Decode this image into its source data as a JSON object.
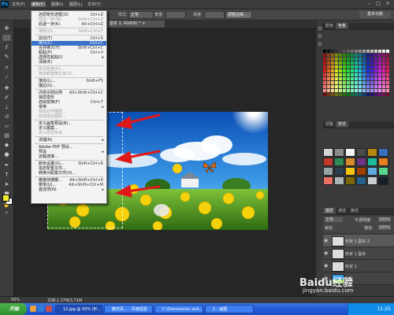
{
  "menubar": {
    "logo": "Ps",
    "items": [
      "文件(F)",
      "编辑(E)",
      "图像(I)",
      "图层(L)",
      "文字(Y)"
    ]
  },
  "optbar": {
    "style_label": "样式:",
    "style_value": "正常",
    "width_label": "宽度:",
    "height_label": "高度:",
    "refine_button": "调整边缘..."
  },
  "document_tab": "副本 2, RGB/8) * ×",
  "edit_menu": {
    "items": [
      {
        "label": "还原矩形选框(O)",
        "shortcut": "Ctrl+Z",
        "disabled": false
      },
      {
        "label": "前进一步(W)",
        "shortcut": "Shift+Ctrl+Z",
        "disabled": true
      },
      {
        "label": "后退一步(K)",
        "shortcut": "Alt+Ctrl+Z",
        "disabled": false
      },
      {
        "label": "",
        "separator": true
      },
      {
        "label": "渐隐(D)...",
        "shortcut": "Shift+Ctrl+F",
        "disabled": true
      },
      {
        "label": "",
        "separator": true
      },
      {
        "label": "剪切(T)",
        "shortcut": "Ctrl+X",
        "disabled": false
      },
      {
        "label": "拷贝(C)",
        "shortcut": "Ctrl+C",
        "disabled": false,
        "selected": true
      },
      {
        "label": "合并拷贝(Y)",
        "shortcut": "Shift+Ctrl+C",
        "disabled": false
      },
      {
        "label": "粘贴(P)",
        "shortcut": "Ctrl+V",
        "disabled": false
      },
      {
        "label": "选择性粘贴(I)",
        "shortcut": "",
        "disabled": false,
        "submenu": true
      },
      {
        "label": "清除(E)",
        "shortcut": "",
        "disabled": false
      },
      {
        "label": "",
        "separator": true
      },
      {
        "label": "拼写检查(H)...",
        "shortcut": "",
        "disabled": true
      },
      {
        "label": "查找和替换文本(X)...",
        "shortcut": "",
        "disabled": true
      },
      {
        "label": "",
        "separator": true
      },
      {
        "label": "填充(L)...",
        "shortcut": "Shift+F5",
        "disabled": false
      },
      {
        "label": "描边(S)...",
        "shortcut": "",
        "disabled": false
      },
      {
        "label": "",
        "separator": true
      },
      {
        "label": "内容识别比例",
        "shortcut": "Alt+Shift+Ctrl+C",
        "disabled": false
      },
      {
        "label": "操控变形",
        "shortcut": "",
        "disabled": false
      },
      {
        "label": "自由变换(F)",
        "shortcut": "Ctrl+T",
        "disabled": false
      },
      {
        "label": "变换",
        "shortcut": "",
        "disabled": false,
        "submenu": true
      },
      {
        "label": "自动对齐图层...",
        "shortcut": "",
        "disabled": true
      },
      {
        "label": "自动混合图层...",
        "shortcut": "",
        "disabled": true
      },
      {
        "label": "",
        "separator": true
      },
      {
        "label": "定义画笔预设(B)...",
        "shortcut": "",
        "disabled": false
      },
      {
        "label": "定义图案...",
        "shortcut": "",
        "disabled": false
      },
      {
        "label": "定义自定形状...",
        "shortcut": "",
        "disabled": true
      },
      {
        "label": "",
        "separator": true
      },
      {
        "label": "清理(R)",
        "shortcut": "",
        "disabled": false,
        "submenu": true
      },
      {
        "label": "",
        "separator": true
      },
      {
        "label": "Adobe PDF 预设...",
        "shortcut": "",
        "disabled": false
      },
      {
        "label": "预设",
        "shortcut": "",
        "disabled": false,
        "submenu": true
      },
      {
        "label": "远程连接...",
        "shortcut": "",
        "disabled": false
      },
      {
        "label": "",
        "separator": true
      },
      {
        "label": "颜色设置(G)...",
        "shortcut": "Shift+Ctrl+K",
        "disabled": false
      },
      {
        "label": "指定配置文件...",
        "shortcut": "",
        "disabled": false
      },
      {
        "label": "转换为配置文件(V)...",
        "shortcut": "",
        "disabled": false
      },
      {
        "label": "",
        "separator": true
      },
      {
        "label": "键盘快捷键...",
        "shortcut": "Alt+Shift+Ctrl+K",
        "disabled": false
      },
      {
        "label": "菜单(U)...",
        "shortcut": "Alt+Shift+Ctrl+M",
        "disabled": false
      },
      {
        "label": "首选项(N)",
        "shortcut": "",
        "disabled": false,
        "submenu": true
      }
    ]
  },
  "right_panels": {
    "workspace": "基本功能",
    "top_tabs": [
      "颜色",
      "色板"
    ],
    "mid_tabs": [
      "调整",
      "样式"
    ],
    "layers_tabs": [
      "图层",
      "通道",
      "路径"
    ],
    "blend_mode": "正常",
    "opacity_label": "不透明度:",
    "opacity_value": "100%",
    "lock_label": "锁定:",
    "fill_label": "填充:",
    "fill_value": "100%",
    "layers": [
      {
        "name": "形状 1 副本 2",
        "selected": true
      },
      {
        "name": "形状 1 副本",
        "selected": false
      },
      {
        "name": "形状 1",
        "selected": false
      },
      {
        "name": "背景",
        "selected": false
      }
    ]
  },
  "statusbar": {
    "zoom": "50%",
    "doc": "文档:1.37M/3.71M"
  },
  "taskbar": {
    "start": "开始",
    "buttons": [
      "12.jpg @ 50% (形...",
      "教你百... - 百度经验",
      "C:\\Documents and...",
      "2 - 画图"
    ],
    "clock": "11:25"
  },
  "watermark": {
    "brand": "Baidu经验",
    "url": "jingyan.baidu.com"
  },
  "colors": {
    "menu_highlight": "#3a70c8",
    "arrow": "#e01818",
    "fg": "#f2ec2a",
    "bg": "#ffffff"
  }
}
